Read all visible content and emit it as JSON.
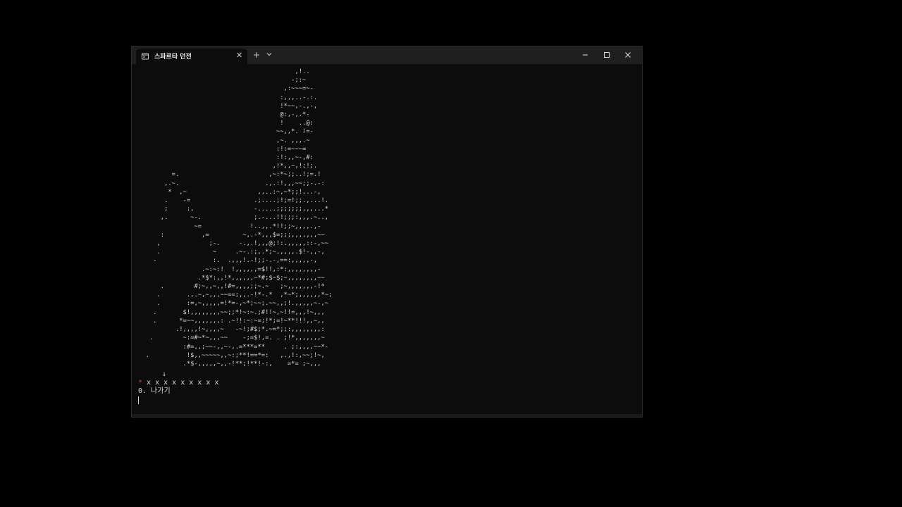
{
  "window": {
    "tab_title": "스파르타 던전",
    "tab_close_glyph": "✕",
    "new_tab_glyph": "+",
    "icons": [
      "terminal-icon",
      "chevron-down-icon",
      "minimize-icon",
      "maximize-icon",
      "close-icon"
    ]
  },
  "terminal": {
    "ascii_art": "                                          ,!..\n                                         -;:~\n                                       ,:~~~=~-\n                                      :,,,..-.:.\n                                      !*~~,-.,-,\n                                      @:,-,.*-\n                                      !    ..@:\n                                     ~~,,*. !=-\n                                     ,~. ,,,.~\n                                     :!:=~~~=\n                                     :!:,,~-,#:\n                                    ,!*,,~,!;!;.\n         =.                        ,~:*~;;..!;=.!\n       ,.~.                       .,.:!,,,~~;;-.-:\n        *  ,~                   ,,..:~,~*;;!,..-,\n       .    -=                 .;....;!;=!;;.,...!.\n       ;     :,                -.....;;;;;;;,,,...*\n      ,.      ~-.              ;.-...!!;;;:,,,.~..,\n               ~=             !..,,.*!!;;~,,,,.,-\n      :          ,=         ~,.-*,,,$=;;;,,,,,,,~~\n     ,             ;-.     -.,.!,,,@;!:.,,,,,::-,~~\n     .              ~     .~-.:;,.*;~,,,,,.$!-,,-,\n    -               :.  .,,,!.-!;;-.-,==:,,,,,-,\n                 .~:~:!  !,,,,,,=$!!,:*:,,,,,,,,-\n                .*$*:,,!*,,,,,,~*#;$~$;~,,,,,,,,~~\n      .        #;~,,~,,!#=,,,,;;~.~   ;~,,,,,,,-!*\n     .       .,.~,~,,,~~==;,,.-!*-.*  ,*~*;,,,,,,*~;\n     .       :=,~,,,,,=!*=-,~*;~~;.~~,,;!.,,,,,~-,~\n    .       $!,,,,,,,,~~;;*!~:~.;#!!~,~!!=,,,!~,,,\n    .      *=~~,,,,,,,: .~!!:~:~=;!*;=!~**!!!,,~,,\n          .!,,,,!~,,,,~   -~!;#$;*.~=*;;:,,,,,,,,:\n   .        ~:=#~*~,,,~~    -;=$!,=. . ;!*,,,,,,,~\n            :#=,,;~~-,,~-,.=***=**     . ;:,,,,~~*-\n  .          !$,,~~~~~,,~:;**!==*=:   ,.,!:,~~;!~,\n            .*$-,,,,,~,,-!**;!**!-:,    =*= ;~,,,\n\n                                                  ",
    "arrow_down": "↓",
    "track_star": "*",
    "track_rest": " x x x x x x x x x",
    "menu_exit": "0. 나가기"
  }
}
